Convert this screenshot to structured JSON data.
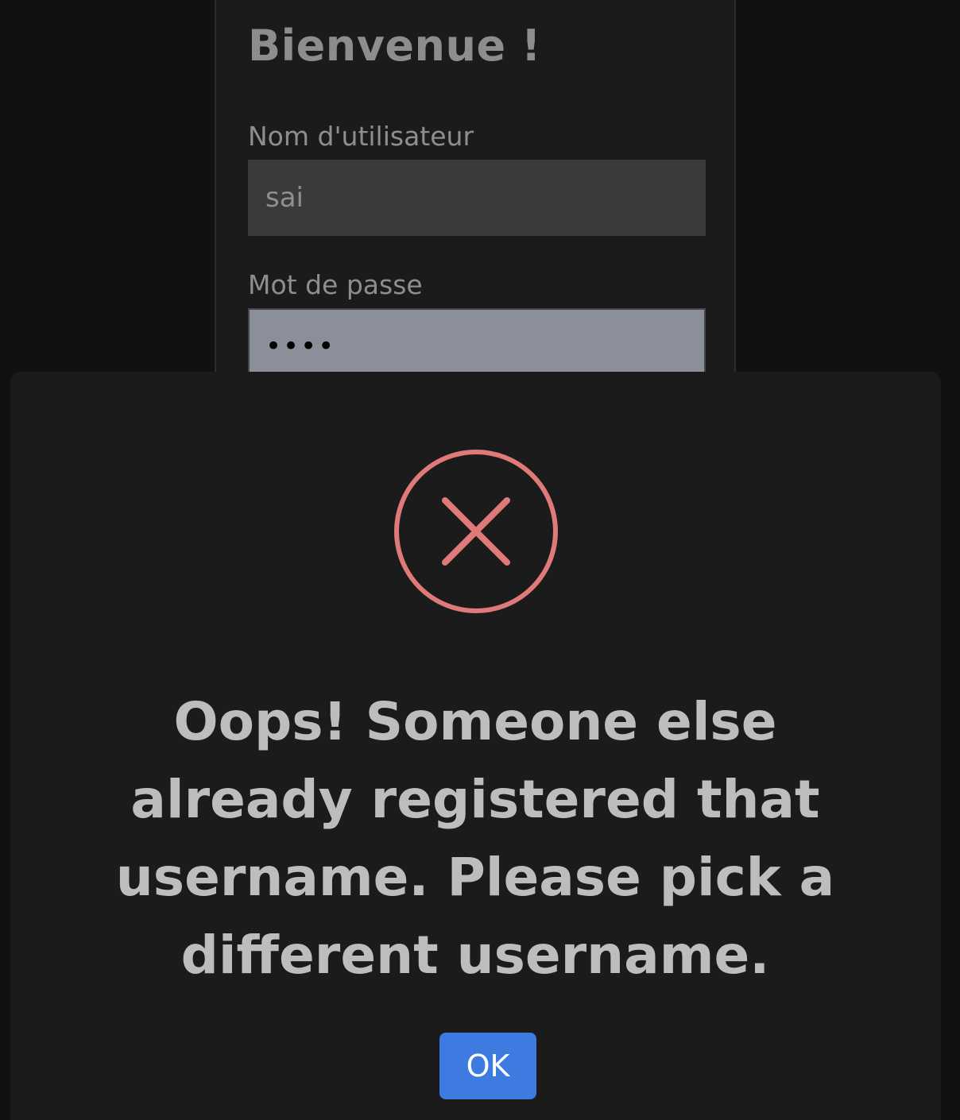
{
  "login": {
    "title": "Bienvenue !",
    "username_label": "Nom d'utilisateur",
    "username_value": "sai",
    "password_label": "Mot de passe",
    "password_value": "••••"
  },
  "modal": {
    "icon": "error-x-circle-icon",
    "icon_color": "#e07a78",
    "message": "Oops! Someone else already registered that username. Please pick a different username.",
    "ok_label": "OK",
    "ok_color": "#3d7be0"
  }
}
